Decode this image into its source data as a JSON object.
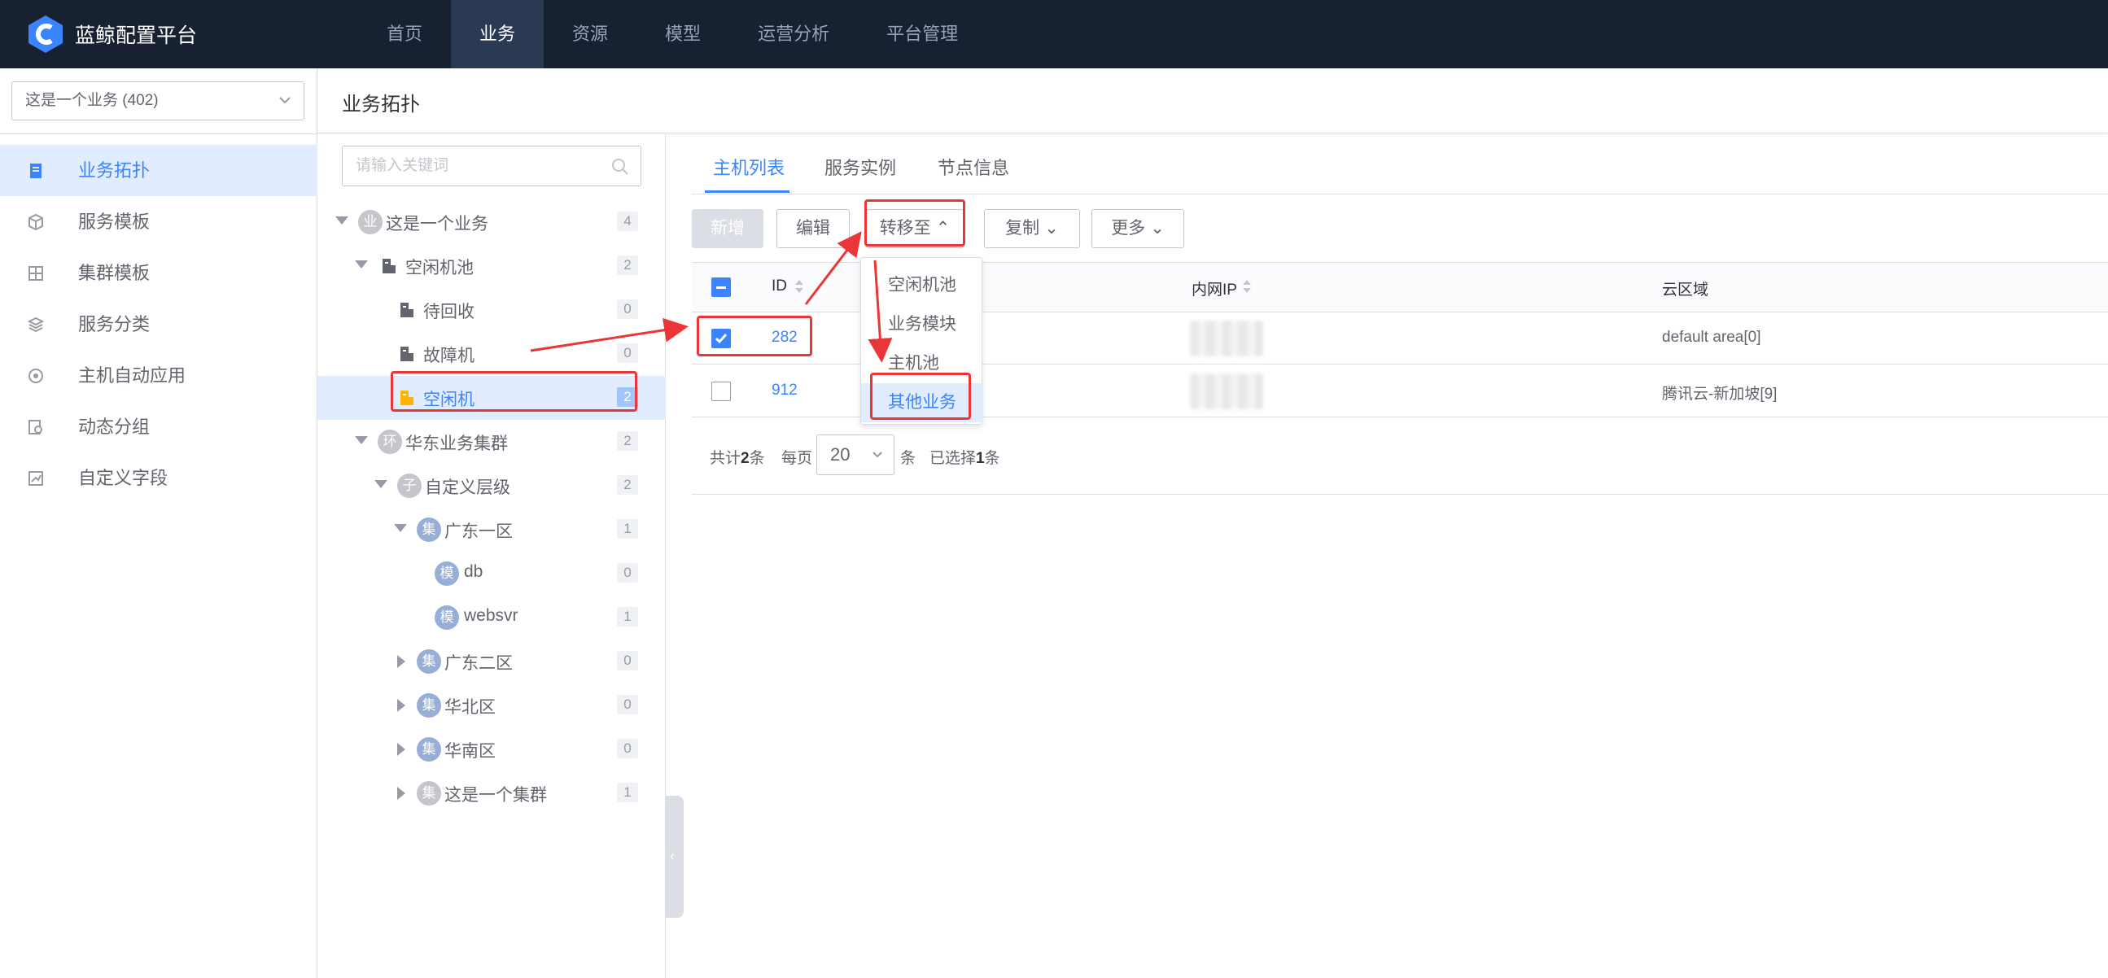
{
  "topbar": {
    "brand": "蓝鲸配置平台",
    "nav": [
      "首页",
      "业务",
      "资源",
      "模型",
      "运营分析",
      "平台管理"
    ],
    "active_nav": "业务"
  },
  "sidebar": {
    "business_select": "这是一个业务 (402)",
    "menu": [
      {
        "label": "业务拓扑",
        "icon": "topology-icon"
      },
      {
        "label": "服务模板",
        "icon": "cube-icon"
      },
      {
        "label": "集群模板",
        "icon": "grid-icon"
      },
      {
        "label": "服务分类",
        "icon": "layers-icon"
      },
      {
        "label": "主机自动应用",
        "icon": "auto-apply-icon"
      },
      {
        "label": "动态分组",
        "icon": "dynamic-group-icon"
      },
      {
        "label": "自定义字段",
        "icon": "custom-field-icon"
      }
    ]
  },
  "page": {
    "title": "业务拓扑"
  },
  "tree": {
    "search_placeholder": "请输入关键词",
    "nodes": [
      {
        "badge": "业",
        "label": "这是一个业务",
        "count": "4"
      },
      {
        "label": "空闲机池",
        "count": "2"
      },
      {
        "label": "待回收",
        "count": "0"
      },
      {
        "label": "故障机",
        "count": "0"
      },
      {
        "label": "空闲机",
        "count": "2"
      },
      {
        "badge": "环",
        "label": "华东业务集群",
        "count": "2"
      },
      {
        "badge": "子",
        "label": "自定义层级",
        "count": "2"
      },
      {
        "badge": "集",
        "label": "广东一区",
        "count": "1"
      },
      {
        "badge": "模",
        "label": "db",
        "count": "0"
      },
      {
        "badge": "模",
        "label": "websvr",
        "count": "1"
      },
      {
        "badge": "集",
        "label": "广东二区",
        "count": "0"
      },
      {
        "badge": "集",
        "label": "华北区",
        "count": "0"
      },
      {
        "badge": "集",
        "label": "华南区",
        "count": "0"
      },
      {
        "badge": "集",
        "label": "这是一个集群",
        "count": "1"
      }
    ]
  },
  "tabs": [
    "主机列表",
    "服务实例",
    "节点信息"
  ],
  "toolbar": {
    "add": "新增",
    "edit": "编辑",
    "transfer": "转移至",
    "copy": "复制",
    "more": "更多"
  },
  "transfer_menu": [
    "空闲机池",
    "业务模块",
    "主机池",
    "其他业务"
  ],
  "table": {
    "columns": [
      "ID",
      "内网IP",
      "云区域"
    ],
    "rows": [
      {
        "id": "282",
        "cloud": "default area[0]",
        "checked": true
      },
      {
        "id": "912",
        "cloud": "腾讯云-新加坡[9]",
        "checked": false
      }
    ]
  },
  "pager": {
    "total_prefix": "共计",
    "total": "2",
    "total_suffix": "条",
    "per_page_label": "每页",
    "per_page": "20",
    "per_page_suffix": "条",
    "selected_prefix": "已选择",
    "selected": "1",
    "selected_suffix": "条"
  },
  "colors": {
    "primary": "#3a84ff",
    "topbar": "#182132",
    "annotation": "#ea3636"
  }
}
